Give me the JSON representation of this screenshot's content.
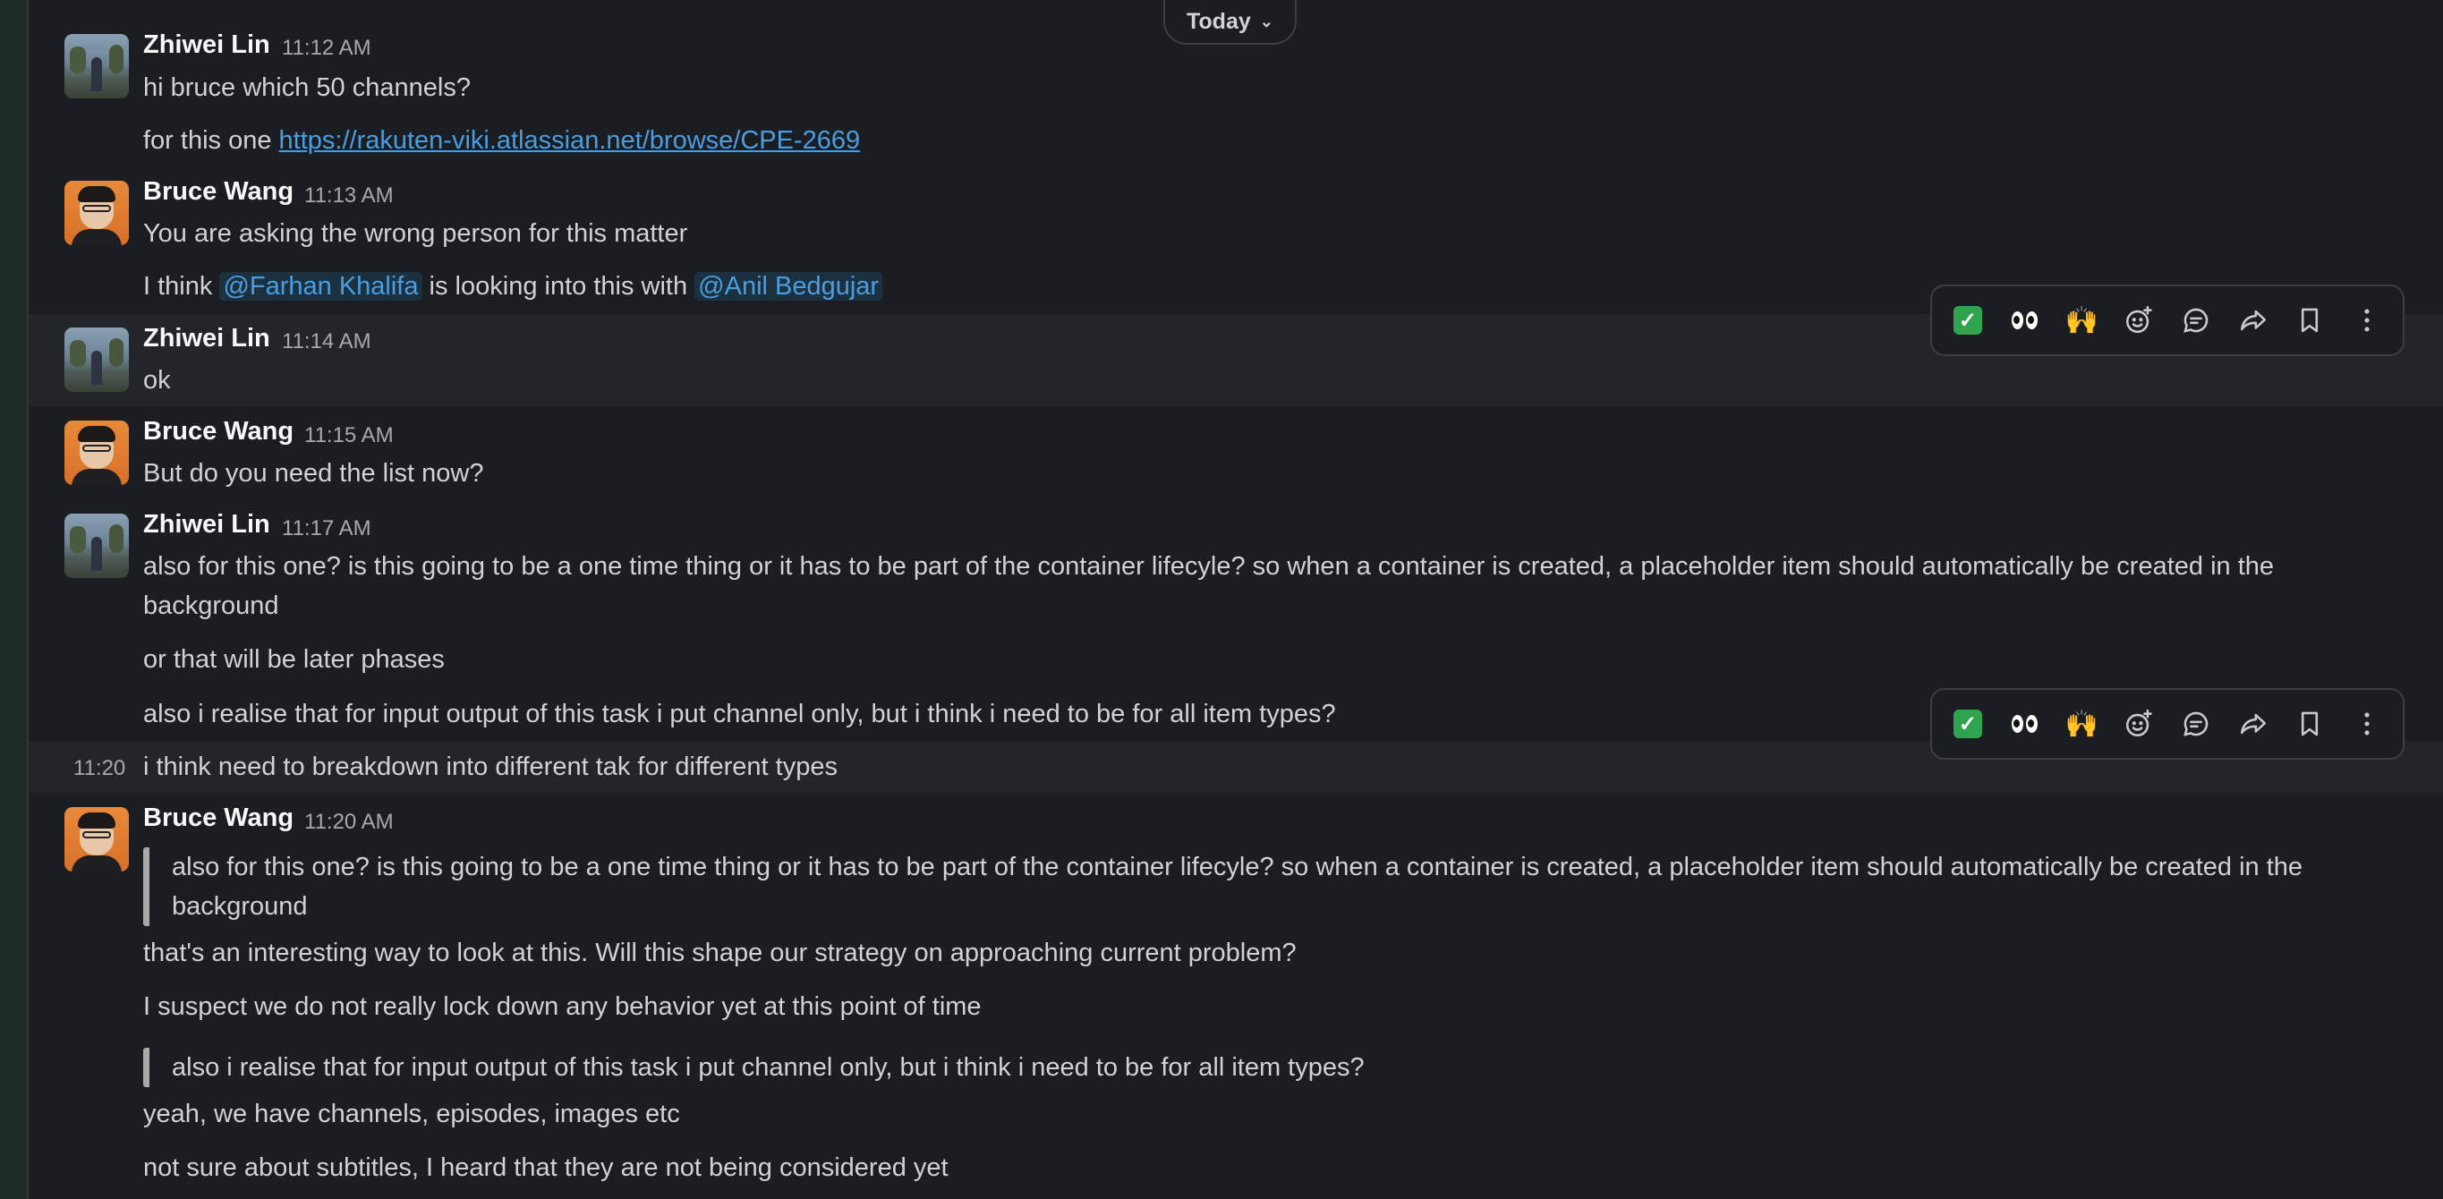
{
  "date_divider": {
    "label": "Today"
  },
  "messages": [
    {
      "author": "Zhiwei Lin",
      "time": "11:12 AM",
      "lines": [
        "hi bruce which 50 channels?"
      ],
      "link_prefix": "for this one ",
      "link": "https://rakuten-viki.atlassian.net/browse/CPE-2669"
    },
    {
      "author": "Bruce Wang",
      "time": "11:13 AM",
      "lines": [
        "You are asking the wrong person for this matter"
      ],
      "mention_line": {
        "pre": "I think ",
        "mention1": "@Farhan Khalifa",
        "mid": " is looking into this with ",
        "mention2": "@Anil Bedgujar"
      }
    },
    {
      "author": "Zhiwei Lin",
      "time": "11:14 AM",
      "lines": [
        "ok"
      ]
    },
    {
      "author": "Bruce Wang",
      "time": "11:15 AM",
      "lines": [
        "But do you need the list now?"
      ]
    },
    {
      "author": "Zhiwei Lin",
      "time": "11:17 AM",
      "lines": [
        "also for this one? is this going to be a one time thing or it has to be part of the container  lifecyle?  so when a container is created, a placeholder item should automatically be created in the background",
        "or that will be later phases",
        "also i realise that for input output of this task i put channel only, but i think i need to be for all item types?"
      ]
    },
    {
      "time": "11:20",
      "lines": [
        "i think need to breakdown into different tak for different types"
      ]
    },
    {
      "author": "Bruce Wang",
      "time": "11:20 AM",
      "quote1": "also for this one? is this going to be a one time thing or it has to be part of the container lifecyle? so when a container is created, a placeholder item should automatically be created in the background",
      "lines": [
        "that's an interesting way to look at this. Will this shape our strategy on approaching current problem?",
        "I suspect we do not really lock down any behavior yet at this point of time"
      ],
      "quote2": "also i realise that for input output of this task i put channel only, but i think i need to be for all item types?",
      "lines2": [
        "yeah, we have channels, episodes, images etc",
        "not sure about subtitles, I heard that they are not being considered yet"
      ]
    }
  ],
  "toolbar": {
    "actions": [
      "white-check-mark",
      "eyes",
      "raised-hands",
      "add-reaction",
      "reply-in-thread",
      "forward",
      "save-for-later",
      "more-actions"
    ]
  }
}
